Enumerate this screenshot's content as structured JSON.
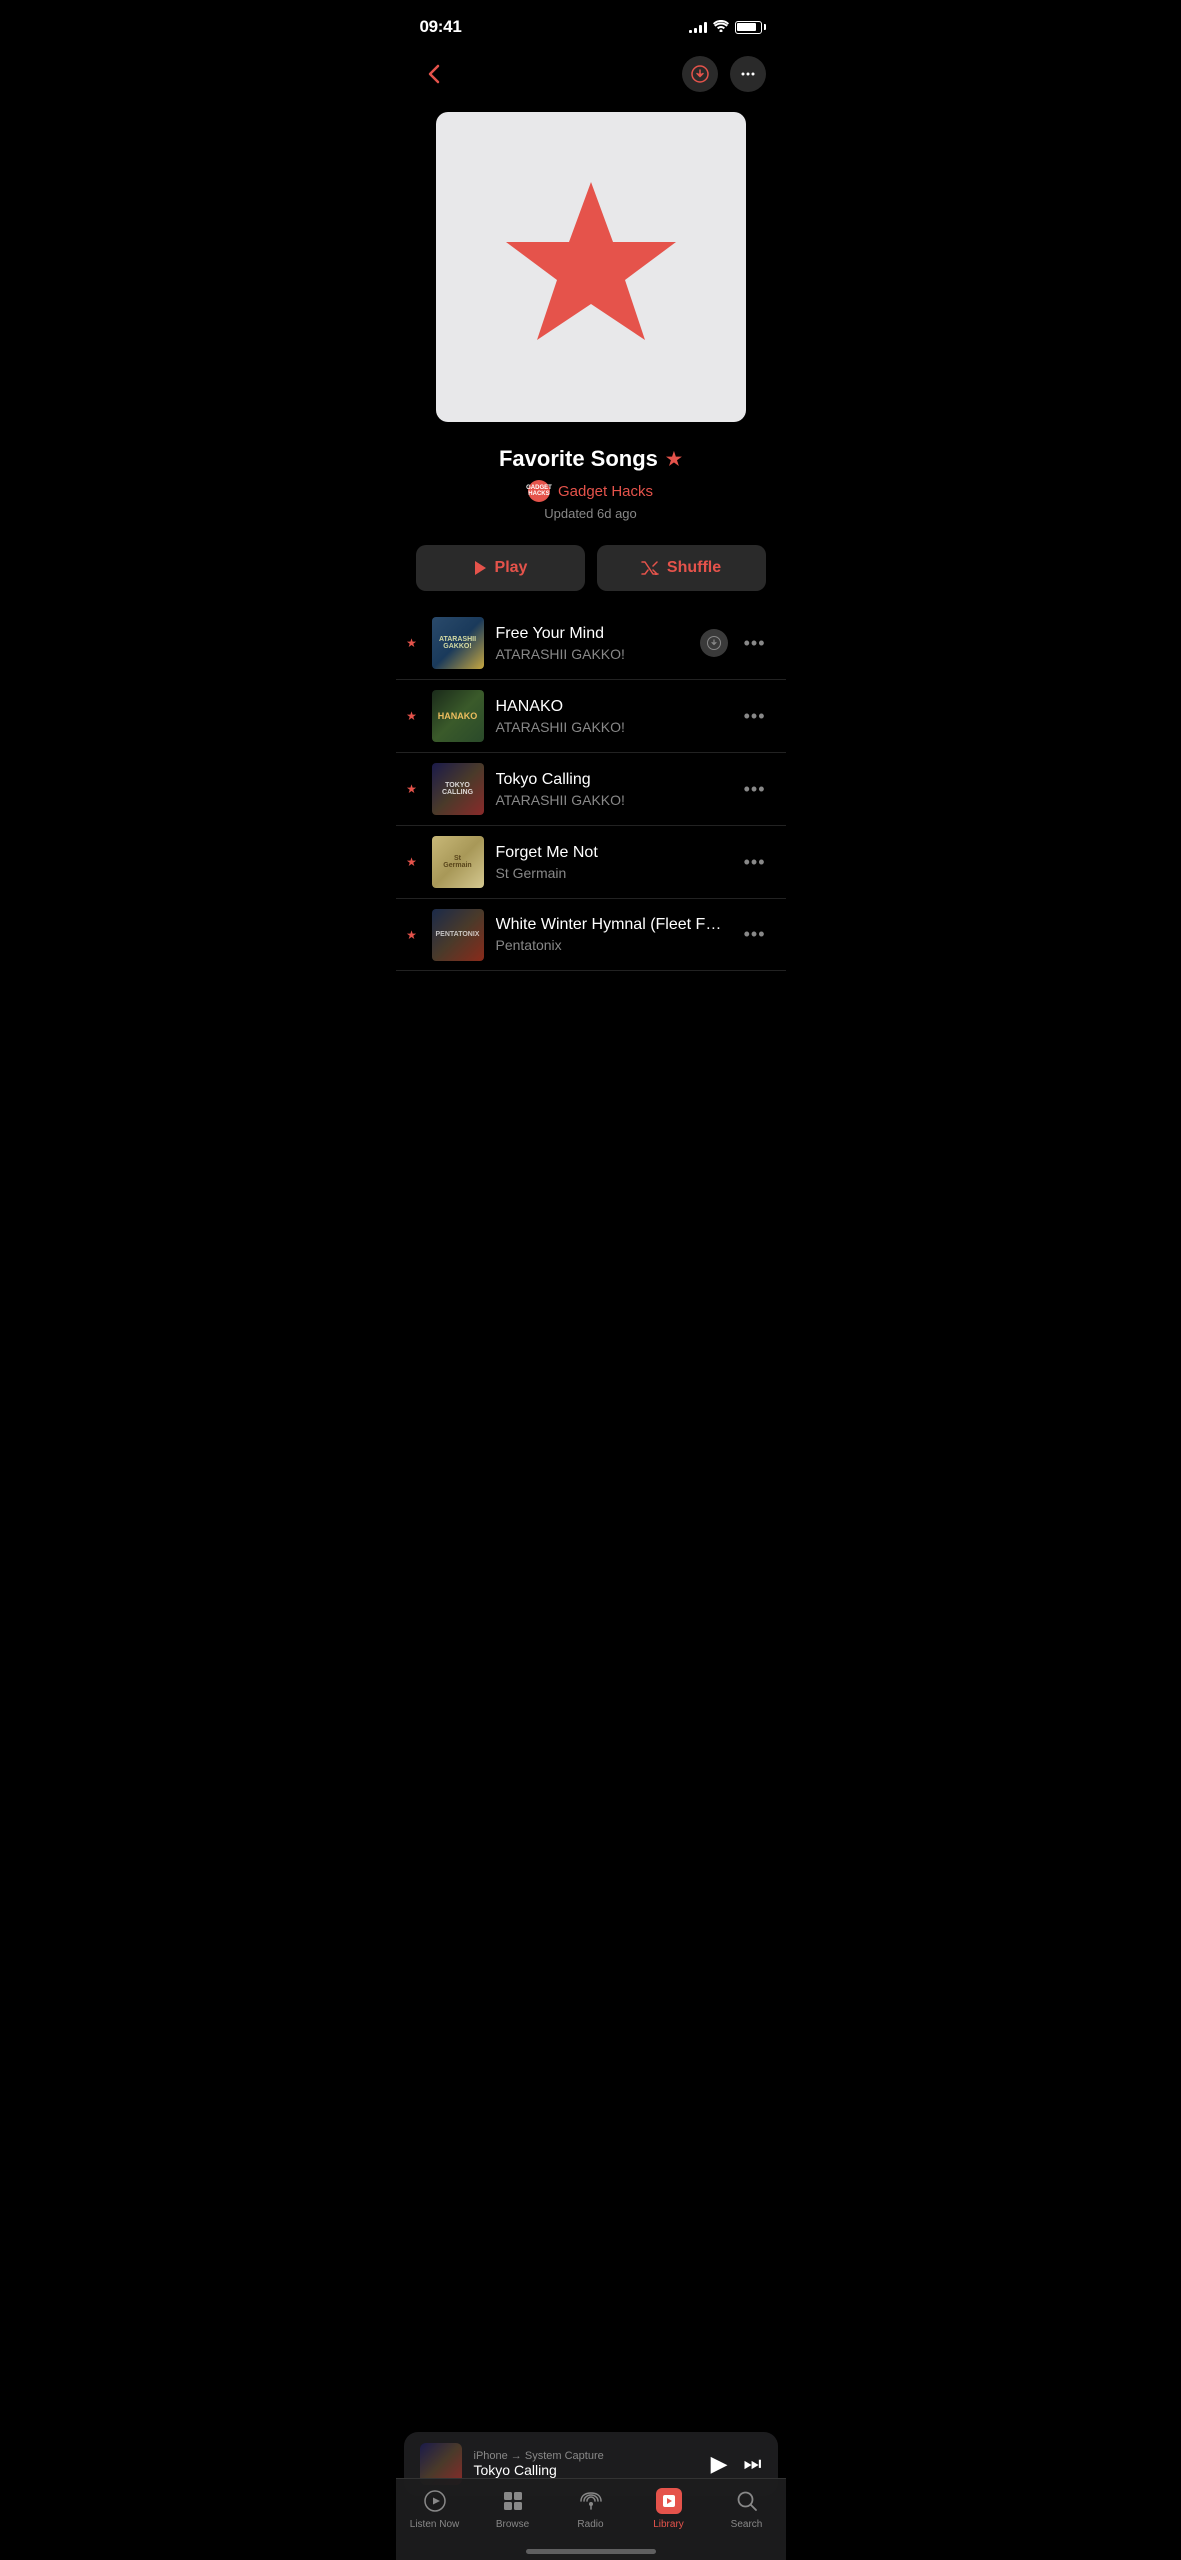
{
  "status": {
    "time": "09:41",
    "signal_bars": [
      4,
      6,
      8,
      10,
      12
    ],
    "battery_level": 85
  },
  "nav": {
    "back_label": "‹",
    "download_icon": "download",
    "more_icon": "more"
  },
  "playlist": {
    "title": "Favorite Songs",
    "title_star": "★",
    "author": "Gadget Hacks",
    "author_initials": "GH",
    "updated": "Updated 6d ago",
    "play_label": "Play",
    "shuffle_label": "Shuffle"
  },
  "songs": [
    {
      "id": 1,
      "title": "Free Your Mind",
      "artist": "ATARASHII GAKKO!",
      "has_download": true,
      "starred": true,
      "thumb_class": "song-thumb-1",
      "thumb_text": "ATARASHII GAKKO!"
    },
    {
      "id": 2,
      "title": "HANAKO",
      "artist": "ATARASHII GAKKO!",
      "has_download": false,
      "starred": true,
      "thumb_class": "song-thumb-2",
      "thumb_text": "HANAKO"
    },
    {
      "id": 3,
      "title": "Tokyo Calling",
      "artist": "ATARASHII GAKKO!",
      "has_download": false,
      "starred": true,
      "thumb_class": "song-thumb-3",
      "thumb_text": "TOKYO CALLING"
    },
    {
      "id": 4,
      "title": "Forget Me Not",
      "artist": "St Germain",
      "has_download": false,
      "starred": true,
      "thumb_class": "song-thumb-4",
      "thumb_text": "St Germain"
    },
    {
      "id": 5,
      "title": "White Winter Hymnal (Fleet Foxes Cover)",
      "artist": "Pentatonix",
      "has_download": false,
      "starred": true,
      "thumb_class": "song-thumb-5",
      "thumb_text": "PENTATONIX"
    }
  ],
  "mini_player": {
    "source": "iPhone → System Capture",
    "title": "Tokyo Calling",
    "play_icon": "▶",
    "forward_icon": "⏭"
  },
  "tab_bar": {
    "items": [
      {
        "id": "listen-now",
        "label": "Listen Now",
        "icon": "▶",
        "active": false
      },
      {
        "id": "browse",
        "label": "Browse",
        "icon": "⊞",
        "active": false
      },
      {
        "id": "radio",
        "label": "Radio",
        "icon": "radio",
        "active": false
      },
      {
        "id": "library",
        "label": "Library",
        "icon": "library",
        "active": true
      },
      {
        "id": "search",
        "label": "Search",
        "icon": "search",
        "active": false
      }
    ]
  }
}
